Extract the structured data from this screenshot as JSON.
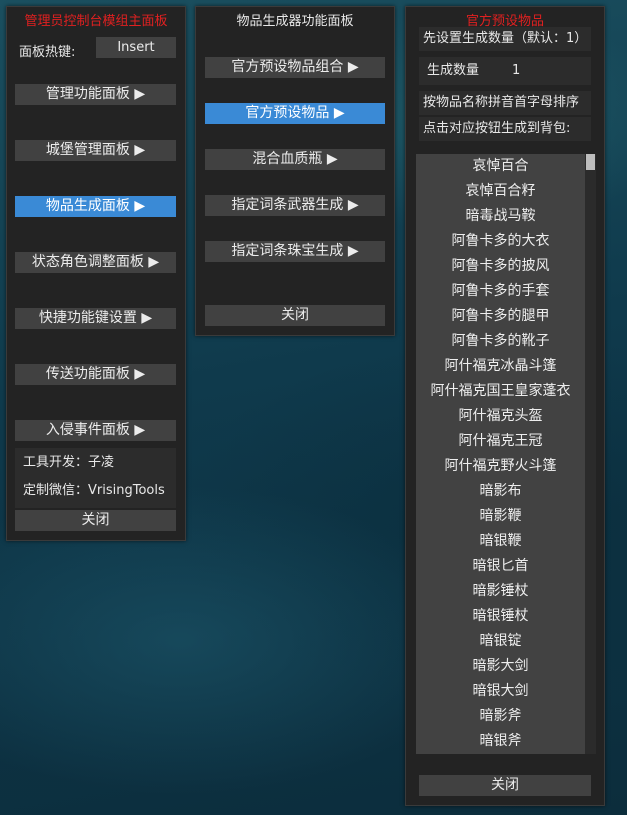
{
  "main_panel": {
    "title": "管理员控制台模组主面板",
    "hotkey_label": "面板热键:",
    "hotkey_value": "Insert",
    "buttons": [
      "管理功能面板 ▶",
      "城堡管理面板 ▶",
      "物品生成面板 ▶",
      "状态角色调整面板 ▶",
      "快捷功能键设置 ▶",
      "传送功能面板 ▶",
      "入侵事件面板 ▶"
    ],
    "dev_label": "工具开发：子凌",
    "wechat_label": "定制微信：VrisingTools",
    "close": "关闭"
  },
  "generator_panel": {
    "title": "物品生成器功能面板",
    "buttons": [
      "官方预设物品组合 ▶",
      "官方预设物品 ▶",
      "混合血质瓶 ▶",
      "指定词条武器生成 ▶",
      "指定词条珠宝生成 ▶"
    ],
    "close": "关闭"
  },
  "items_panel": {
    "title": "官方预设物品",
    "info1": "先设置生成数量（默认：1）",
    "quantity_label": "生成数量",
    "quantity_value": "1",
    "info2": "按物品名称拼音首字母排序",
    "info3": "点击对应按钮生成到背包:",
    "items": [
      "哀悼百合",
      "哀悼百合籽",
      "暗毒战马鞍",
      "阿鲁卡多的大衣",
      "阿鲁卡多的披风",
      "阿鲁卡多的手套",
      "阿鲁卡多的腿甲",
      "阿鲁卡多的靴子",
      "阿什福克冰晶斗篷",
      "阿什福克国王皇家蓬衣",
      "阿什福克头盔",
      "阿什福克王冠",
      "阿什福克野火斗篷",
      "暗影布",
      "暗影鞭",
      "暗银鞭",
      "暗银匕首",
      "暗影锤杖",
      "暗银锤杖",
      "暗银锭",
      "暗影大剑",
      "暗银大剑",
      "暗影斧",
      "暗银斧"
    ],
    "close": "关闭"
  },
  "colors": {
    "title_red": "#e02020",
    "active_blue": "#3a8ad6",
    "button_gray": "#414141",
    "panel_bg": "#232323"
  }
}
